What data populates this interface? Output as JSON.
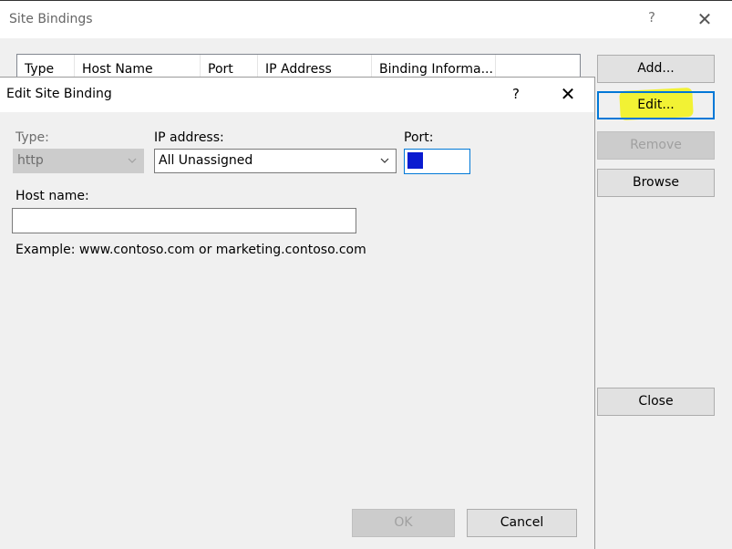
{
  "outer": {
    "title": "Site Bindings",
    "help_glyph": "?",
    "close_glyph": "✕",
    "columns": [
      "Type",
      "Host Name",
      "Port",
      "IP Address",
      "Binding Informa..."
    ],
    "buttons": {
      "add": "Add...",
      "edit": "Edit...",
      "remove": "Remove",
      "browse": "Browse",
      "close": "Close"
    },
    "highlight_color": "#f2f20a"
  },
  "dialog": {
    "title": "Edit Site Binding",
    "help_glyph": "?",
    "close_glyph": "✕",
    "type_label": "Type:",
    "type_value": "http",
    "ip_label": "IP address:",
    "ip_value": "All Unassigned",
    "port_label": "Port:",
    "port_value": "",
    "host_label": "Host name:",
    "host_value": "",
    "example_text": "Example: www.contoso.com or marketing.contoso.com",
    "ok_label": "OK",
    "cancel_label": "Cancel"
  },
  "colors": {
    "focus": "#0078d7",
    "selection": "#0a1bd0"
  }
}
